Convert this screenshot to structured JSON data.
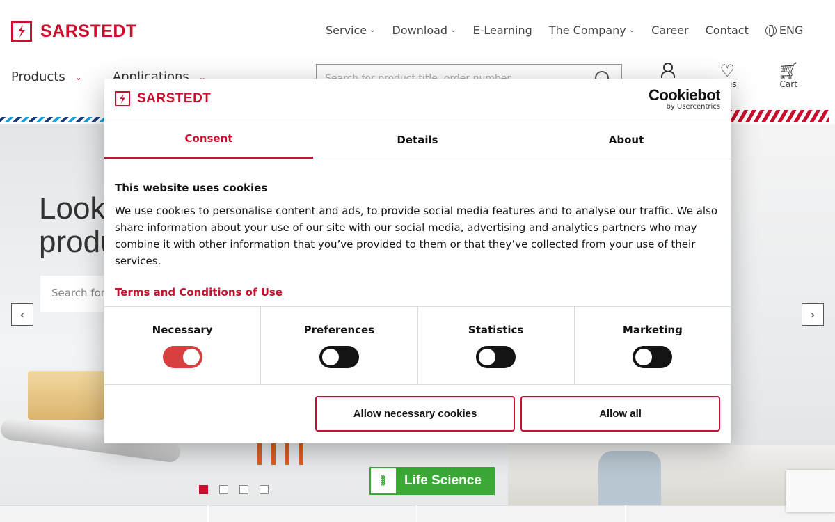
{
  "brand": {
    "name": "SARSTEDT",
    "color": "#c8102e"
  },
  "topnav": [
    {
      "label": "Service",
      "dropdown": true
    },
    {
      "label": "Download",
      "dropdown": true
    },
    {
      "label": "E-Learning",
      "dropdown": false
    },
    {
      "label": "The Company",
      "dropdown": true
    },
    {
      "label": "Career",
      "dropdown": false
    },
    {
      "label": "Contact",
      "dropdown": false
    }
  ],
  "language": "ENG",
  "mainnav": [
    {
      "label": "Products"
    },
    {
      "label": "Applications"
    }
  ],
  "search": {
    "placeholder": "Search for product title, order number"
  },
  "header_icons": {
    "account": "user-icon",
    "favorites_label": "rites",
    "cart_label": "Cart"
  },
  "hero": {
    "title_line1": "Look",
    "title_line2": "produ",
    "search_placeholder": "Search for",
    "prev": "‹",
    "next": "›",
    "slides": 4,
    "active_slide": 1,
    "badge": "Life Science"
  },
  "cookie_dialog": {
    "logo": "SARSTEDT",
    "provider": "Cookiebot",
    "provider_sub": "by Usercentrics",
    "tabs": [
      {
        "label": "Consent",
        "active": true
      },
      {
        "label": "Details",
        "active": false
      },
      {
        "label": "About",
        "active": false
      }
    ],
    "heading": "This website uses cookies",
    "text": "We use cookies to personalise content and ads, to provide social media features and to analyse our traffic. We also share information about your use of our site with our social media, advertising and analytics partners who may combine it with other information that you’ve provided to them or that they’ve collected from your use of their services.",
    "terms_link": "Terms and Conditions of Use",
    "toggles": [
      {
        "label": "Necessary",
        "on": true
      },
      {
        "label": "Preferences",
        "on": false
      },
      {
        "label": "Statistics",
        "on": false
      },
      {
        "label": "Marketing",
        "on": false
      }
    ],
    "buttons": {
      "necessary": "Allow necessary cookies",
      "all": "Allow all"
    }
  }
}
